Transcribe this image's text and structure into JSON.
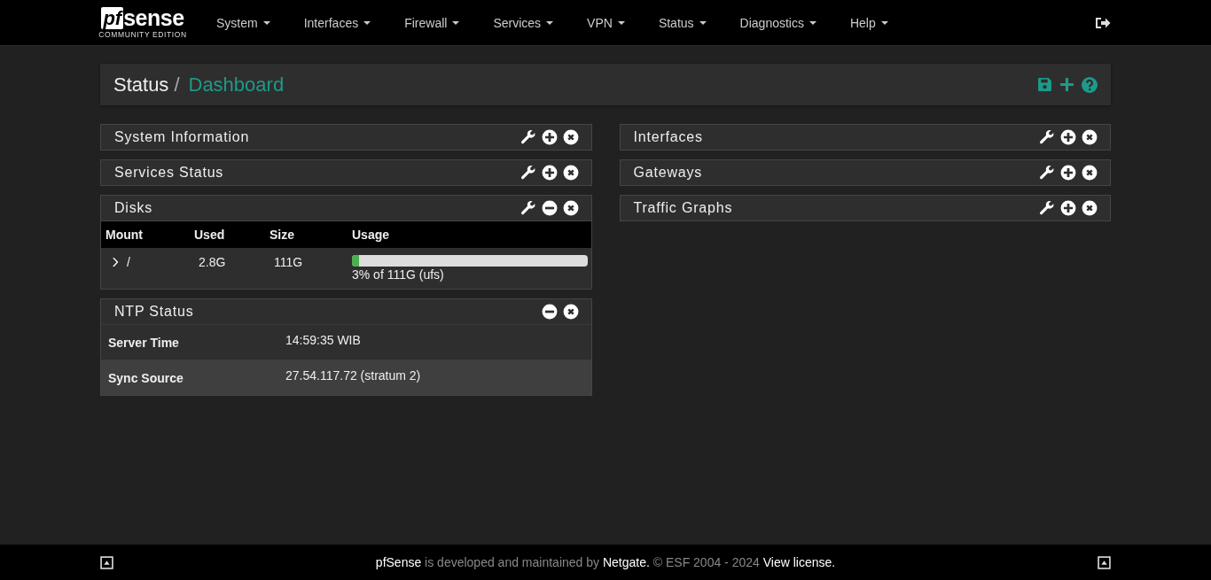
{
  "navbar": {
    "logo": {
      "mark": "pf",
      "word": "sense",
      "edition": "COMMUNITY EDITION"
    },
    "menus": [
      {
        "label": "System"
      },
      {
        "label": "Interfaces"
      },
      {
        "label": "Firewall"
      },
      {
        "label": "Services"
      },
      {
        "label": "VPN"
      },
      {
        "label": "Status"
      },
      {
        "label": "Diagnostics"
      },
      {
        "label": "Help"
      }
    ]
  },
  "breadcrumb": {
    "parent": "Status",
    "separator": "/",
    "current": "Dashboard"
  },
  "columns": [
    {
      "widgets": [
        {
          "title": "System Information",
          "settings": true,
          "expanded": false
        },
        {
          "title": "Services Status",
          "settings": true,
          "expanded": false
        },
        {
          "title": "Disks",
          "settings": true,
          "expanded": true,
          "kind": "disks",
          "table": {
            "columns": [
              "Mount",
              "Used",
              "Size",
              "Usage"
            ],
            "rows": [
              {
                "mount": "/",
                "used": "2.8G",
                "size": "111G",
                "level": 0.03,
                "usage": "3% of 111G (ufs)"
              }
            ]
          }
        },
        {
          "title": "NTP Status",
          "settings": false,
          "expanded": true,
          "kind": "ntp",
          "rows": [
            {
              "label": "Server Time",
              "value": "14:59:35 WIB"
            },
            {
              "label": "Sync Source",
              "value": "27.54.117.72 (stratum 2)"
            }
          ]
        }
      ]
    },
    {
      "widgets": [
        {
          "title": "Interfaces",
          "settings": true,
          "expanded": false
        },
        {
          "title": "Gateways",
          "settings": true,
          "expanded": false
        },
        {
          "title": "Traffic Graphs",
          "settings": true,
          "expanded": false
        }
      ]
    }
  ],
  "footer": {
    "parts": [
      {
        "kind": "link",
        "text": "pfSense"
      },
      {
        "kind": "text",
        "text": " is developed and maintained by "
      },
      {
        "kind": "link",
        "text": "Netgate"
      },
      {
        "kind": "link",
        "text": "."
      },
      {
        "kind": "text",
        "text": " © ESF 2004 - 2024 "
      },
      {
        "kind": "link",
        "text": "View license."
      }
    ]
  }
}
